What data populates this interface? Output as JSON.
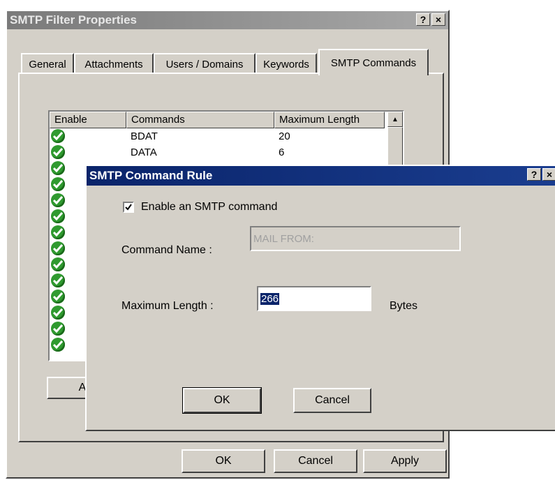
{
  "main_window": {
    "title": "SMTP Filter Properties",
    "help_button": "?",
    "close_button": "×",
    "tabs": [
      {
        "label": "General"
      },
      {
        "label": "Attachments"
      },
      {
        "label": "Users / Domains"
      },
      {
        "label": "Keywords"
      },
      {
        "label": "SMTP Commands",
        "active": true
      }
    ],
    "list": {
      "columns": [
        "Enable",
        "Commands",
        "Maximum Length"
      ],
      "rows": [
        {
          "enabled": true,
          "command": "BDAT",
          "max_length": "20"
        },
        {
          "enabled": true,
          "command": "DATA",
          "max_length": "6"
        },
        {
          "enabled": true,
          "command": "",
          "max_length": ""
        },
        {
          "enabled": true,
          "command": "",
          "max_length": ""
        },
        {
          "enabled": true,
          "command": "",
          "max_length": ""
        },
        {
          "enabled": true,
          "command": "",
          "max_length": ""
        },
        {
          "enabled": true,
          "command": "",
          "max_length": ""
        },
        {
          "enabled": true,
          "command": "",
          "max_length": ""
        },
        {
          "enabled": true,
          "command": "",
          "max_length": ""
        },
        {
          "enabled": true,
          "command": "",
          "max_length": ""
        },
        {
          "enabled": true,
          "command": "",
          "max_length": ""
        },
        {
          "enabled": true,
          "command": "",
          "max_length": ""
        },
        {
          "enabled": true,
          "command": "",
          "max_length": ""
        },
        {
          "enabled": true,
          "command": "",
          "max_length": ""
        }
      ]
    },
    "add_button_partial": "Ac",
    "ok_label": "OK",
    "cancel_label": "Cancel",
    "apply_label": "Apply"
  },
  "dialog": {
    "title": "SMTP Command Rule",
    "help_button": "?",
    "close_button": "×",
    "enable_checkbox": {
      "checked": true,
      "label": "Enable an SMTP command"
    },
    "command_name": {
      "label": "Command Name :",
      "value": "MAIL FROM:"
    },
    "max_length": {
      "label": "Maximum Length :",
      "value": "266",
      "unit": "Bytes"
    },
    "ok_label": "OK",
    "cancel_label": "Cancel"
  },
  "colors": {
    "dialog_face": "#d4d0c8",
    "main_titlebar": "#8a8a8a",
    "active_titlebar": "#0a246a",
    "check_green": "#2f9a2f",
    "selection": "#0a246a"
  }
}
